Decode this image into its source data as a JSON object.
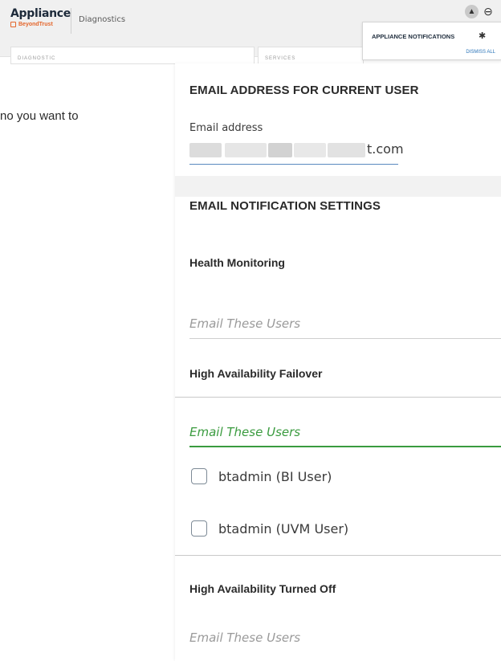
{
  "app": {
    "title": "Appliance",
    "vendor": "BeyondTrust",
    "breadcrumb": "Diagnostics",
    "bg_card1_label": "DIAGNOSTIC",
    "bg_card2_label": "SERVICES",
    "partial_text": "no you want to"
  },
  "notifications": {
    "title": "APPLIANCE NOTIFICATIONS",
    "dismiss_label": "DISMISS ALL"
  },
  "panel": {
    "current_user_heading": "EMAIL ADDRESS FOR CURRENT USER",
    "email_label": "Email address",
    "email_value_visible": "t.com",
    "notification_heading": "EMAIL NOTIFICATION SETTINGS",
    "sections": [
      {
        "title": "Health Monitoring",
        "placeholder": "Email These Users"
      },
      {
        "title": "High Availability Failover",
        "placeholder": "Email These Users",
        "users": [
          "btadmin (BI User)",
          "btadmin (UVM User)"
        ]
      },
      {
        "title": "High Availability Turned Off",
        "placeholder": "Email These Users"
      }
    ]
  },
  "colors": {
    "accent_green": "#3a9b3f",
    "brand_orange": "#e4662c",
    "link_blue": "#2a74b8"
  }
}
